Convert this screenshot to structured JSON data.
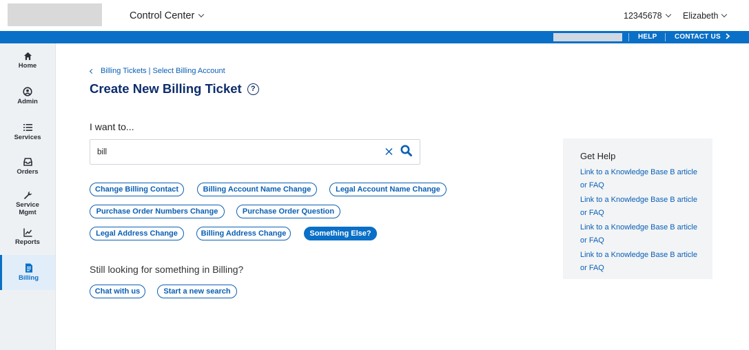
{
  "header": {
    "app_switcher": "Control Center",
    "account_number": "12345678",
    "user_name": "Elizabeth"
  },
  "utility_bar": {
    "help": "HELP",
    "contact": "CONTACT US"
  },
  "sidebar": {
    "items": [
      {
        "label": "Home",
        "icon": "home-icon"
      },
      {
        "label": "Admin",
        "icon": "user-circle-icon"
      },
      {
        "label": "Services",
        "icon": "list-icon"
      },
      {
        "label": "Orders",
        "icon": "inbox-icon"
      },
      {
        "label": "Service Mgmt",
        "icon": "wrench-icon"
      },
      {
        "label": "Reports",
        "icon": "chart-icon"
      },
      {
        "label": "Billing",
        "icon": "billing-doc-icon",
        "active": true
      }
    ]
  },
  "breadcrumb": {
    "link1": "Billing Tickets",
    "separator": "|",
    "link2": "Select Billing Account"
  },
  "page": {
    "title": "Create New Billing Ticket",
    "help_glyph": "?",
    "prompt": "I want to...",
    "search_value": "bill",
    "still_looking": "Still looking for something in Billing?"
  },
  "suggestions": [
    "Change Billing Contact",
    "Billing Account Name Change",
    "Legal Account Name Change",
    "Purchase Order Numbers Change",
    "Purchase Order Question",
    "Legal Address Change",
    "Billing Address Change",
    "Something Else?"
  ],
  "actions": {
    "chat": "Chat with us",
    "new_search": "Start a new search"
  },
  "get_help": {
    "title": "Get Help",
    "links": [
      "Link to a Knowledge Base B article or FAQ",
      "Link to a Knowledge Base B article or FAQ",
      "Link to a Knowledge Base B article or FAQ",
      "Link to a Knowledge Base B article or FAQ"
    ]
  },
  "colors": {
    "brand_blue": "#0a6fc6",
    "title_navy": "#0d2d6b",
    "link_blue": "#0a5fb4"
  }
}
